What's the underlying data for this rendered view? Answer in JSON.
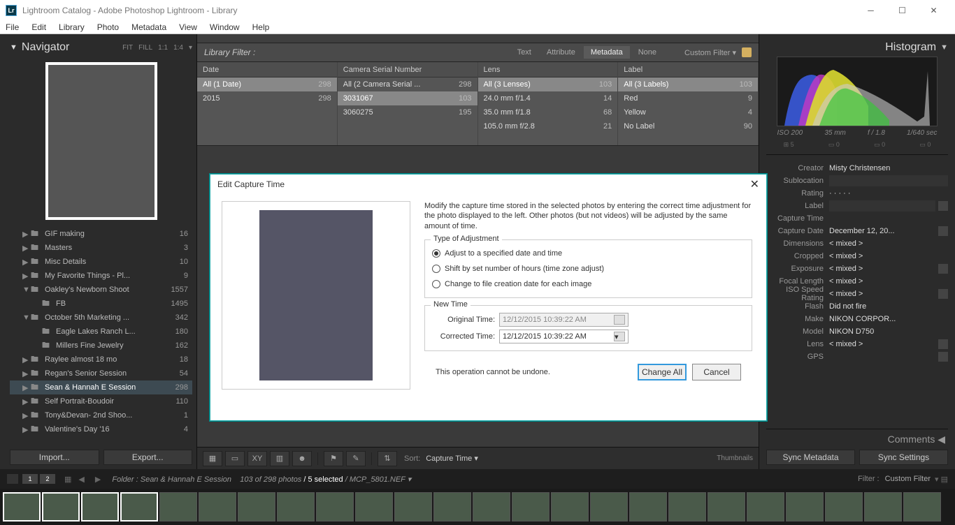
{
  "window": {
    "title": "Lightroom Catalog - Adobe Photoshop Lightroom - Library",
    "lr": "Lr"
  },
  "menu": [
    "File",
    "Edit",
    "Library",
    "Photo",
    "Metadata",
    "View",
    "Window",
    "Help"
  ],
  "navigator": {
    "title": "Navigator",
    "modes": [
      "FIT",
      "FILL",
      "1:1",
      "1:4"
    ]
  },
  "folders": [
    {
      "name": "GIF making",
      "count": 16,
      "indent": 1
    },
    {
      "name": "Masters",
      "count": 3,
      "indent": 1
    },
    {
      "name": "Misc Details",
      "count": 10,
      "indent": 1
    },
    {
      "name": "My Favorite Things - Pl...",
      "count": 9,
      "indent": 1
    },
    {
      "name": "Oakley's Newborn Shoot",
      "count": 1557,
      "indent": 1,
      "exp": true
    },
    {
      "name": "FB",
      "count": 1495,
      "indent": 2
    },
    {
      "name": "October 5th Marketing ...",
      "count": 342,
      "indent": 1,
      "exp": true
    },
    {
      "name": "Eagle Lakes Ranch L...",
      "count": 180,
      "indent": 2
    },
    {
      "name": "Millers Fine Jewelry",
      "count": 162,
      "indent": 2
    },
    {
      "name": "Raylee almost 18 mo",
      "count": 18,
      "indent": 1
    },
    {
      "name": "Regan's Senior Session",
      "count": 54,
      "indent": 1
    },
    {
      "name": "Sean & Hannah E Session",
      "count": 298,
      "indent": 1,
      "sel": true
    },
    {
      "name": "Self Portrait-Boudoir",
      "count": 110,
      "indent": 1
    },
    {
      "name": "Tony&Devan- 2nd Shoo...",
      "count": 1,
      "indent": 1
    },
    {
      "name": "Valentine's Day '16",
      "count": 4,
      "indent": 1
    }
  ],
  "buttons": {
    "import": "Import...",
    "export": "Export..."
  },
  "libfilter": {
    "label": "Library Filter :",
    "tabs": [
      "Text",
      "Attribute",
      "Metadata",
      "None"
    ],
    "active": "Metadata",
    "custom": "Custom Filter"
  },
  "metacols": [
    {
      "name": "Date",
      "rows": [
        {
          "n": "All (1 Date)",
          "c": 298,
          "sel": true
        },
        {
          "n": "2015",
          "c": 298
        }
      ]
    },
    {
      "name": "Camera Serial Number",
      "rows": [
        {
          "n": "All (2 Camera Serial ...",
          "c": 298
        },
        {
          "n": "3031067",
          "c": 103,
          "sel": true
        },
        {
          "n": "3060275",
          "c": 195
        }
      ]
    },
    {
      "name": "Lens",
      "rows": [
        {
          "n": "All (3 Lenses)",
          "c": 103,
          "sel": true
        },
        {
          "n": "24.0 mm f/1.4",
          "c": 14
        },
        {
          "n": "35.0 mm f/1.8",
          "c": 68
        },
        {
          "n": "105.0 mm f/2.8",
          "c": 21
        }
      ]
    },
    {
      "name": "Label",
      "rows": [
        {
          "n": "All (3 Labels)",
          "c": 103,
          "sel": true
        },
        {
          "n": "Red",
          "c": 9
        },
        {
          "n": "Yellow",
          "c": 4
        },
        {
          "n": "No Label",
          "c": 90
        }
      ]
    }
  ],
  "toolbar": {
    "sort_label": "Sort:",
    "sort_value": "Capture Time",
    "thumbs": "Thumbnails"
  },
  "histogram": {
    "title": "Histogram",
    "stats": [
      "ISO 200",
      "35 mm",
      "f / 1.8",
      "1/640 sec"
    ],
    "icons": [
      "⊞ 5",
      "▭ 0",
      "▭ 0",
      "▭ 0"
    ]
  },
  "metafields": [
    {
      "l": "Creator",
      "v": "Misty Christensen"
    },
    {
      "l": "Sublocation",
      "v": "",
      "inp": true
    },
    {
      "l": "Rating",
      "v": "· · · · ·"
    },
    {
      "l": "Label",
      "v": "",
      "inp": true,
      "ic": true
    },
    {
      "l": "Capture Time",
      "v": ""
    },
    {
      "l": "Capture Date",
      "v": "December 12, 20...",
      "ic": true
    },
    {
      "l": "Dimensions",
      "v": "< mixed >"
    },
    {
      "l": "Cropped",
      "v": "< mixed >"
    },
    {
      "l": "Exposure",
      "v": "< mixed >",
      "ic": true
    },
    {
      "l": "Focal Length",
      "v": "< mixed >"
    },
    {
      "l": "ISO Speed Rating",
      "v": "< mixed >",
      "ic": true
    },
    {
      "l": "Flash",
      "v": "Did not fire"
    },
    {
      "l": "Make",
      "v": "NIKON CORPOR..."
    },
    {
      "l": "Model",
      "v": "NIKON D750"
    },
    {
      "l": "Lens",
      "v": "< mixed >",
      "ic": true
    },
    {
      "l": "GPS",
      "v": "",
      "ic": true
    }
  ],
  "comments": "Comments",
  "sync": {
    "meta": "Sync Metadata",
    "settings": "Sync Settings"
  },
  "status": {
    "pages": [
      "1",
      "2"
    ],
    "crumb_folder": "Folder : Sean & Hannah E Session",
    "crumb_count": "103 of 298 photos",
    "crumb_sel": "/ 5 selected",
    "crumb_file": "/ MCP_5801.NEF",
    "filter_label": "Filter :",
    "filter_value": "Custom Filter"
  },
  "dialog": {
    "title": "Edit Capture Time",
    "desc": "Modify the capture time stored in the selected photos by entering the correct time adjustment for the photo displayed to the left. Other photos (but not videos) will be adjusted by the same amount of time.",
    "group1": "Type of Adjustment",
    "radio1": "Adjust to a specified date and time",
    "radio2": "Shift by set number of hours (time zone adjust)",
    "radio3": "Change to file creation date for each image",
    "group2": "New Time",
    "orig_label": "Original Time:",
    "corr_label": "Corrected Time:",
    "orig_val": "12/12/2015 10:39:22 AM",
    "corr_val": "12/12/2015 10:39:22 AM",
    "warn": "This operation cannot be undone.",
    "change_all": "Change All",
    "cancel": "Cancel"
  }
}
